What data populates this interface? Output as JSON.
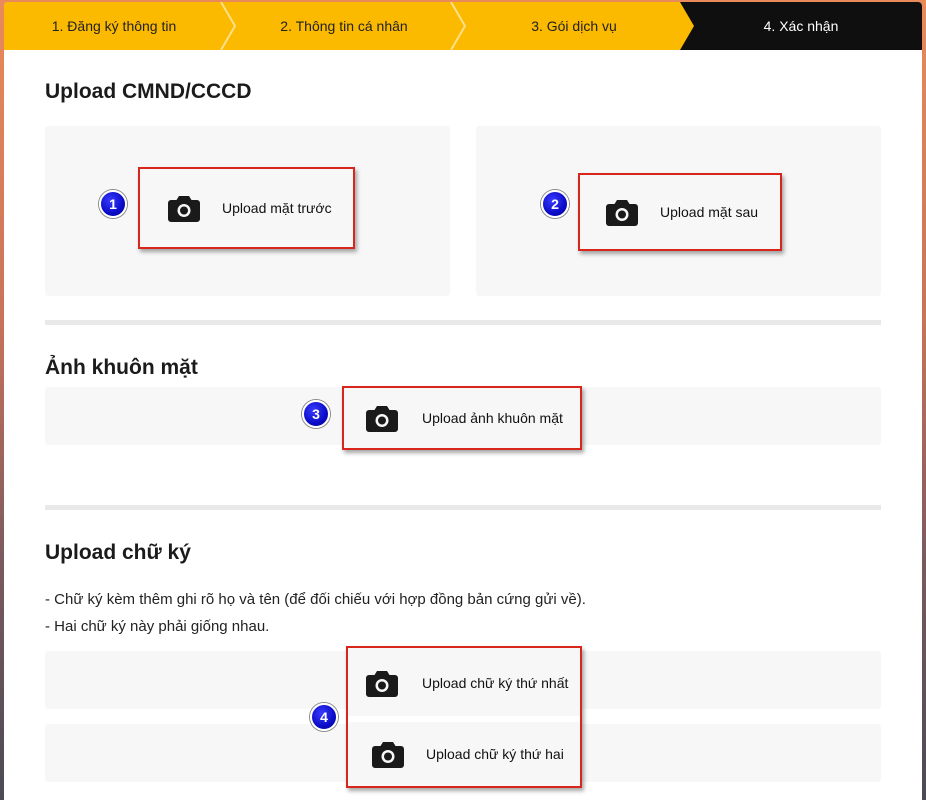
{
  "stepper": {
    "steps": [
      {
        "label": "1. Đăng ký thông tin"
      },
      {
        "label": "2. Thông tin cá nhân"
      },
      {
        "label": "3. Gói dịch vụ"
      },
      {
        "label": "4. Xác nhận"
      }
    ],
    "active_index": 3
  },
  "id_section": {
    "title": "Upload CMND/CCCD",
    "front_label": "Upload mặt trước",
    "back_label": "Upload mặt sau"
  },
  "face_section": {
    "title": "Ảnh khuôn mặt",
    "upload_label": "Upload ảnh khuôn mặt"
  },
  "signature_section": {
    "title": "Upload chữ ký",
    "notes": [
      "- Chữ ký kèm thêm ghi rõ họ và tên (để đối chiếu với hợp đồng bản cứng gửi về).",
      "- Hai chữ ký này phải giống nhau."
    ],
    "first_label": "Upload chữ ký thứ nhất",
    "second_label": "Upload chữ ký thứ hai"
  },
  "badges": [
    "1",
    "2",
    "3",
    "4"
  ],
  "colors": {
    "stepper_bg": "#fbb900",
    "active_step_bg": "#0f0f0f",
    "highlight_border": "#d9261c",
    "badge_blue": "#0b0bc8"
  },
  "icons": {
    "upload": "camera-icon"
  }
}
